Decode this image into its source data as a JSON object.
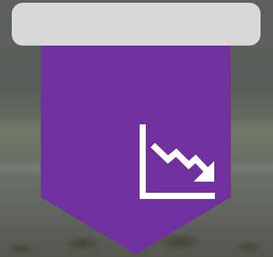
{
  "banner": {
    "icon": "trending-down-chart-icon",
    "color": "#70309d"
  },
  "top_bar": {
    "color": "#d8d8d8"
  }
}
